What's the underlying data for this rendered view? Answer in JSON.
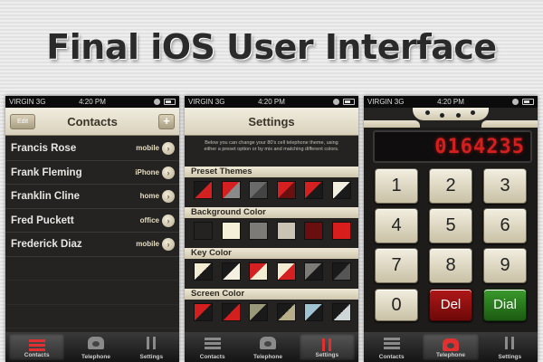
{
  "headline": "Final iOS User Interface",
  "statusbar": {
    "carrier": "VIRGIN",
    "network": "3G",
    "time": "4:20 PM"
  },
  "tabs": [
    {
      "label": "Contacts",
      "icon": "contacts-icon"
    },
    {
      "label": "Telephone",
      "icon": "telephone-icon"
    },
    {
      "label": "Settings",
      "icon": "settings-icon"
    }
  ],
  "contacts_screen": {
    "title": "Contacts",
    "edit_label": "Edit",
    "add_label": "+",
    "contacts": [
      {
        "name": "Francis Rose",
        "type": "mobile"
      },
      {
        "name": "Frank Fleming",
        "type": "iPhone"
      },
      {
        "name": "Franklin Cline",
        "type": "home"
      },
      {
        "name": "Fred Puckett",
        "type": "office"
      },
      {
        "name": "Frederick Diaz",
        "type": "mobile"
      }
    ]
  },
  "settings_screen": {
    "title": "Settings",
    "description": "Below you can change your 80's cell telephone theme, using either a preset option or by mix and matching different colors.",
    "sections": [
      {
        "title": "Preset Themes",
        "swatches": [
          [
            "#1a1a1a",
            "#d42020"
          ],
          [
            "#d42020",
            "#8a8a8a"
          ],
          [
            "#6a6a6a",
            "#444444"
          ],
          [
            "#d42020",
            "#6a1010"
          ],
          [
            "#d42020",
            "#1a1a1a"
          ],
          [
            "#f2eedf",
            "#1a1a1a"
          ]
        ]
      },
      {
        "title": "Background Color",
        "swatches": [
          [
            "#242322",
            "#242322"
          ],
          [
            "#f4efd9",
            "#f4efd9"
          ],
          [
            "#7c7b78",
            "#7c7b78"
          ],
          [
            "#c8c3b3",
            "#c8c3b3"
          ],
          [
            "#6a0f0f",
            "#6a0f0f"
          ],
          [
            "#d81d1d",
            "#d81d1d"
          ]
        ]
      },
      {
        "title": "Key Color",
        "swatches": [
          [
            "#f2ecd2",
            "#1a1a1a"
          ],
          [
            "#1a1a1a",
            "#f4f0e2"
          ],
          [
            "#d42020",
            "#f2ecd2"
          ],
          [
            "#f2ecd2",
            "#d42020"
          ],
          [
            "#7c7b78",
            "#1a1a1a"
          ],
          [
            "#1a1a1a",
            "#555555"
          ]
        ]
      },
      {
        "title": "Screen Color",
        "swatches": [
          [
            "#d41f1f",
            "#1a1a1a"
          ],
          [
            "#1a1a1a",
            "#d41f1f"
          ],
          [
            "#9a9a7a",
            "#1a1a1a"
          ],
          [
            "#1a1a1a",
            "#b7b08a"
          ],
          [
            "#9fc3d0",
            "#1a1a1a"
          ],
          [
            "#1a1a1a",
            "#cfd6d8"
          ]
        ]
      }
    ]
  },
  "telephone_screen": {
    "display_number": "0164235",
    "keys": [
      "1",
      "2",
      "3",
      "4",
      "5",
      "6",
      "7",
      "8",
      "9",
      "0",
      "Del",
      "Dial"
    ]
  }
}
